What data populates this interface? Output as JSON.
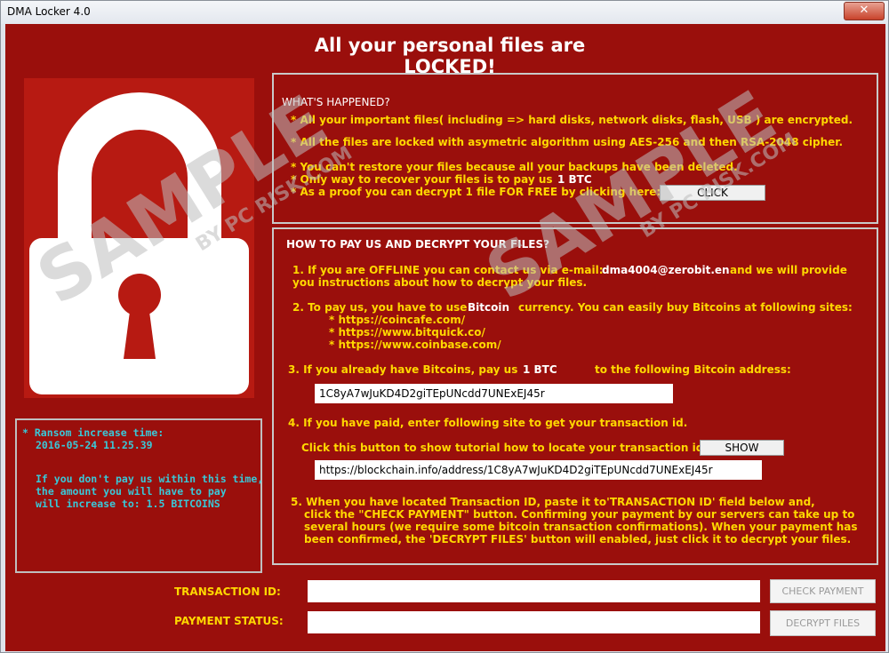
{
  "window": {
    "title": "DMA Locker 4.0",
    "close_label": "✕"
  },
  "heading": "All your personal files are LOCKED!",
  "timer": {
    "label": "* Ransom increase time:",
    "date": "2016-05-24 11.25.39",
    "warning1": "If you don't pay us within this time,",
    "warning2": "the amount you will have to pay",
    "warning3": "will increase to:  1.5 BITCOINS"
  },
  "happened": {
    "title": "WHAT'S HAPPENED?",
    "line1": "* All your important files( including => hard disks, network disks, flash, USB ) are encrypted.",
    "line2": "* All the files are locked with asymetric algorithm using AES-256 and then RSA-2048 cipher.",
    "line3": "* You can't restore your files because all your backups have been deleted.",
    "line4": "* Only way to recover your files is to pay us",
    "line4_amount": "1 BTC",
    "line5": "* As a proof you can decrypt 1 file FOR FREE by clicking here:",
    "click_label": "CLICK"
  },
  "howto": {
    "title": "HOW TO PAY US AND DECRYPT YOUR FILES?",
    "s1_a": "1. If you are OFFLINE you can contact us via e-mail:",
    "s1_email": "dma4004@zerobit.en",
    "s1_b": "and we will provide",
    "s1_c": "you instructions about how to decrypt your files.",
    "s2_a": "2. To pay us, you have to use",
    "s2_currency": "Bitcoin",
    "s2_b": "currency. You can easily buy Bitcoins at following sites:",
    "sites": [
      "* https://coincafe.com/",
      "* https://www.bitquick.co/",
      "* https://www.coinbase.com/"
    ],
    "s3_a": "3. If you already have Bitcoins, pay us",
    "s3_amount": "1 BTC",
    "s3_b": "to the following Bitcoin address:",
    "address": "1C8yA7wJuKD4D2giTEpUNcdd7UNExEJ45r",
    "s4": "4. If you have paid, enter following site to get your transaction id.",
    "s4_tutorial": "Click this button to show tutorial how to locate your transaction id:",
    "show_label": "SHOW",
    "tx_url": "https://blockchain.info/address/1C8yA7wJuKD4D2giTEpUNcdd7UNExEJ45r",
    "s5_1": "5. When you have located Transaction ID, paste it to'TRANSACTION ID' field below and,",
    "s5_2": "click the   \"CHECK PAYMENT\"   button. Confirming your payment by our servers can take up to",
    "s5_3": "several hours (we require some bitcoin transaction confirmations). When your payment has",
    "s5_4": "been confirmed, the 'DECRYPT FILES' button will enabled, just click it to decrypt your files."
  },
  "form": {
    "transaction_label": "TRANSACTION ID:",
    "transaction_value": "",
    "status_label": "PAYMENT STATUS:",
    "status_value": "",
    "check_label": "CHECK PAYMENT",
    "decrypt_label": "DECRYPT FILES"
  },
  "watermark": {
    "big": "SAMPLE",
    "small": "BY PC RISK.COM"
  },
  "colors": {
    "background": "#9a0f0c",
    "accent_yellow": "#ffd800",
    "accent_cyan": "#39c8d8"
  }
}
